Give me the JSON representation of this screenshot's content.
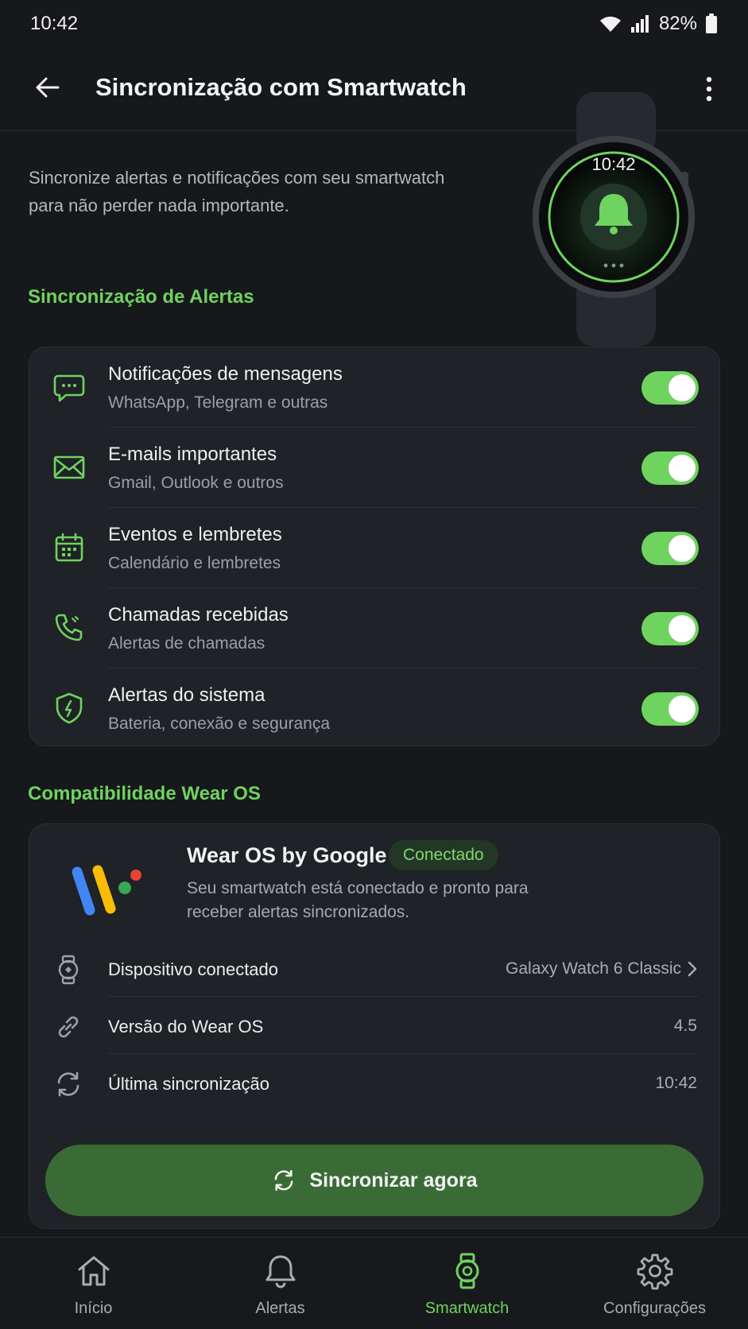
{
  "status_bar": {
    "time": "10:42",
    "battery": "82%"
  },
  "header": {
    "title": "Sincronização com Smartwatch"
  },
  "intro": "Sincronize alertas e notificações com seu smartwatch para não perder nada importante.",
  "watch_face": {
    "time": "10:42"
  },
  "alerts_section": {
    "title": "Sincronização de Alertas",
    "items": [
      {
        "title": "Notificações de mensagens",
        "subtitle": "WhatsApp, Telegram e outras",
        "enabled": true,
        "icon": "chat-icon"
      },
      {
        "title": "E-mails importantes",
        "subtitle": "Gmail, Outlook e outros",
        "enabled": true,
        "icon": "mail-icon"
      },
      {
        "title": "Eventos e lembretes",
        "subtitle": "Calendário e lembretes",
        "enabled": true,
        "icon": "calendar-icon"
      },
      {
        "title": "Chamadas recebidas",
        "subtitle": "Alertas de chamadas",
        "enabled": true,
        "icon": "phone-icon"
      },
      {
        "title": "Alertas do sistema",
        "subtitle": "Bateria, conexão e segurança",
        "enabled": true,
        "icon": "shield-icon"
      }
    ]
  },
  "wear_section": {
    "title": "Compatibilidade Wear OS",
    "name": "Wear OS by Google",
    "badge": "Conectado",
    "description": "Seu smartwatch está conectado e pronto para receber alertas sincronizados.",
    "rows": [
      {
        "label": "Dispositivo conectado",
        "value": "Galaxy Watch 6 Classic",
        "icon": "watch-icon"
      },
      {
        "label": "Versão do Wear OS",
        "value": "4.5",
        "icon": "link-icon"
      },
      {
        "label": "Última sincronização",
        "value": "10:42",
        "icon": "sync-icon"
      }
    ]
  },
  "sync_button": {
    "label": "Sincronizar agora"
  },
  "nav": {
    "items": [
      {
        "label": "Início",
        "icon": "home-icon"
      },
      {
        "label": "Alertas",
        "icon": "bell-icon"
      },
      {
        "label": "Smartwatch",
        "icon": "watch-icon",
        "active": true
      },
      {
        "label": "Configurações",
        "icon": "gear-icon"
      }
    ]
  },
  "colors": {
    "accent": "#6fd35f",
    "background": "#16181b",
    "card": "#1f2226",
    "button": "#3a6b37"
  }
}
